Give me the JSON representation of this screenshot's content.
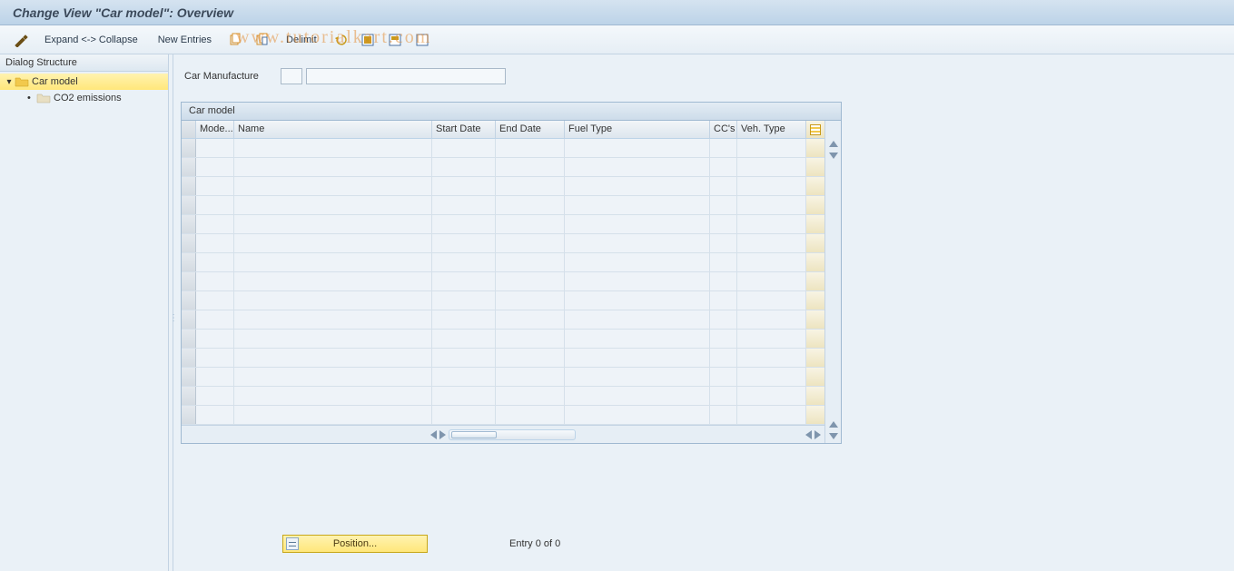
{
  "title": "Change View \"Car model\": Overview",
  "toolbar": {
    "expand_collapse": "Expand <-> Collapse",
    "new_entries": "New Entries",
    "delimit": "Delimit"
  },
  "tree": {
    "header": "Dialog Structure",
    "root_label": "Car model",
    "child_label": "CO2 emissions"
  },
  "field": {
    "label": "Car Manufacture",
    "short_value": "",
    "long_value": ""
  },
  "table": {
    "title": "Car model",
    "columns": {
      "mode": "Mode...",
      "name": "Name",
      "start_date": "Start Date",
      "end_date": "End Date",
      "fuel_type": "Fuel Type",
      "cc": "CC's",
      "veh_type": "Veh. Type"
    },
    "row_count": 15
  },
  "footer": {
    "position_label": "Position...",
    "entry_status": "Entry 0 of 0"
  },
  "watermark": "www.tutorialkart.com"
}
